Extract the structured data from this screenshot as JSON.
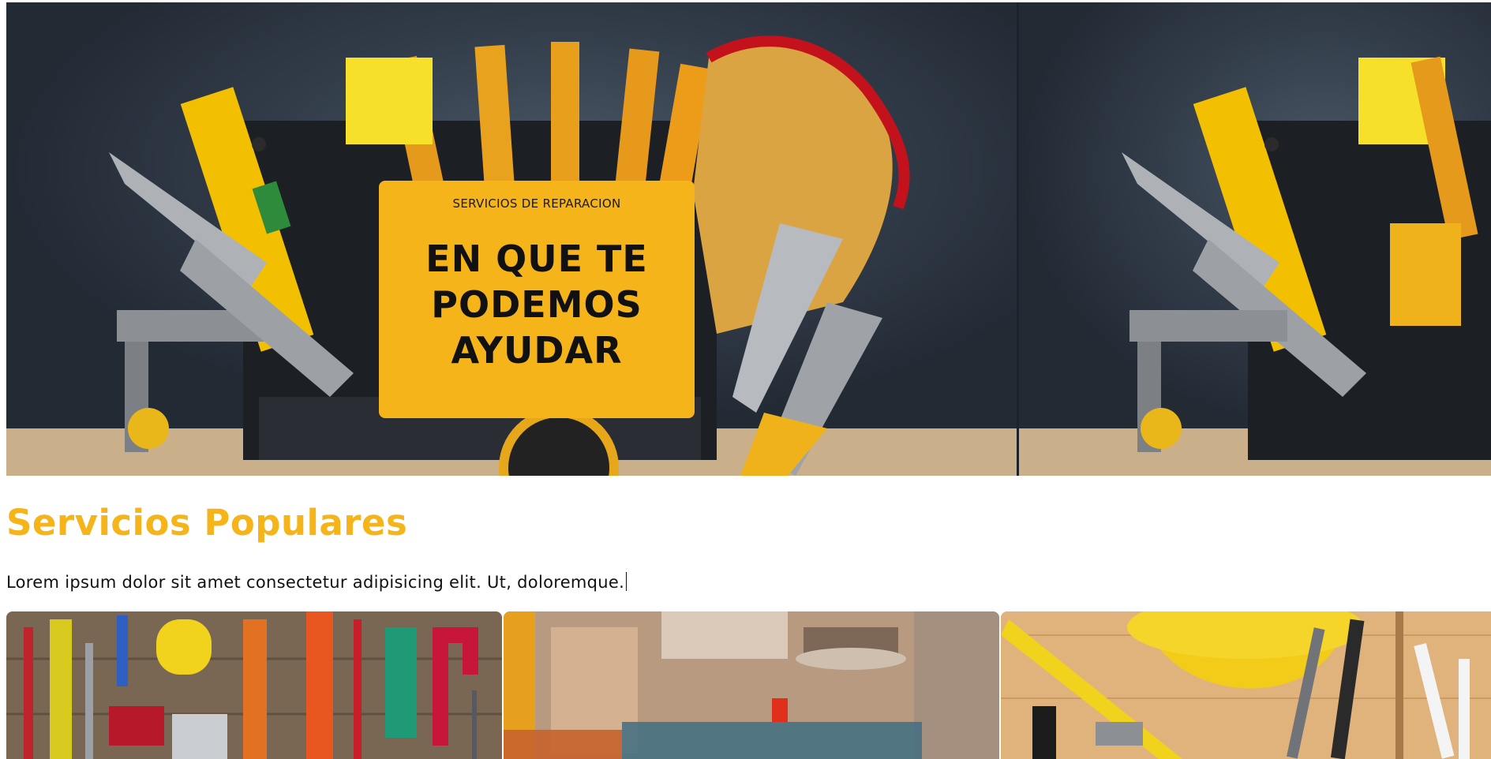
{
  "hero": {
    "eyebrow": "SERVICIOS DE REPARACION",
    "title": "EN QUE TE PODEMOS AYUDAR",
    "card_color": "#f4b41a"
  },
  "popular": {
    "title": "Servicios Populares",
    "text": "Lorem ipsum dolor sit amet consectetur adipisicing elit. Ut, doloremque.",
    "accent_color": "#f4b41a"
  }
}
